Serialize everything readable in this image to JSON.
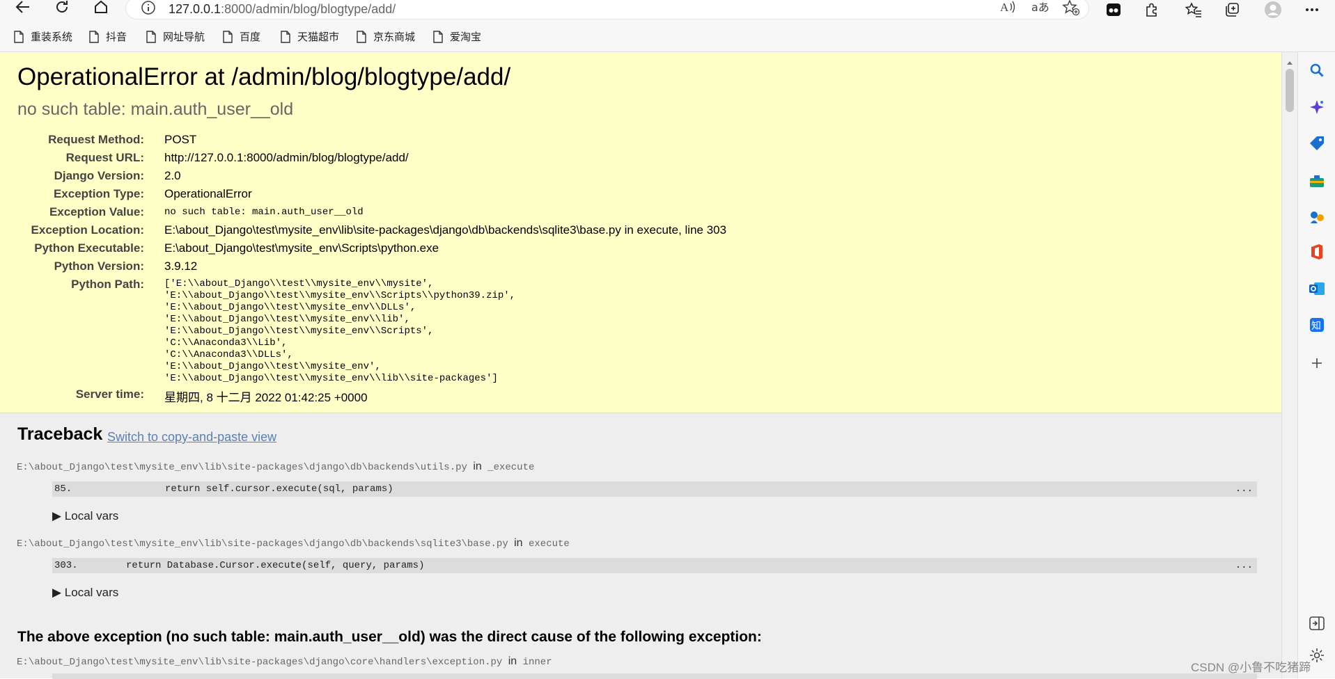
{
  "browser": {
    "url_host": "127.0.0.1",
    "url_path": ":8000/admin/blog/blogtype/add/",
    "bookmarks": [
      "重装系统",
      "抖音",
      "网址导航",
      "百度",
      "天猫超市",
      "京东商城",
      "爱淘宝"
    ]
  },
  "error": {
    "title": "OperationalError at /admin/blog/blogtype/add/",
    "subtitle": "no such table: main.auth_user__old",
    "meta": [
      {
        "key": "Request Method:",
        "value": "POST"
      },
      {
        "key": "Request URL:",
        "value": "http://127.0.0.1:8000/admin/blog/blogtype/add/"
      },
      {
        "key": "Django Version:",
        "value": "2.0"
      },
      {
        "key": "Exception Type:",
        "value": "OperationalError"
      },
      {
        "key": "Exception Value:",
        "value": "no such table: main.auth_user__old"
      },
      {
        "key": "Exception Location:",
        "value": "E:\\about_Django\\test\\mysite_env\\lib\\site-packages\\django\\db\\backends\\sqlite3\\base.py in execute, line 303"
      },
      {
        "key": "Python Executable:",
        "value": "E:\\about_Django\\test\\mysite_env\\Scripts\\python.exe"
      },
      {
        "key": "Python Version:",
        "value": "3.9.12"
      },
      {
        "key": "Python Path:",
        "value": ""
      }
    ],
    "python_path": [
      "['E:\\\\about_Django\\\\test\\\\mysite_env\\\\mysite',",
      " 'E:\\\\about_Django\\\\test\\\\mysite_env\\\\Scripts\\\\python39.zip',",
      " 'E:\\\\about_Django\\\\test\\\\mysite_env\\\\DLLs',",
      " 'E:\\\\about_Django\\\\test\\\\mysite_env\\\\lib',",
      " 'E:\\\\about_Django\\\\test\\\\mysite_env\\\\Scripts',",
      " 'C:\\\\Anaconda3\\\\Lib',",
      " 'C:\\\\Anaconda3\\\\DLLs',",
      " 'E:\\\\about_Django\\\\test\\\\mysite_env',",
      " 'E:\\\\about_Django\\\\test\\\\mysite_env\\\\lib\\\\site-packages']"
    ],
    "server_time_key": "Server time:",
    "server_time": "星期四, 8 十二月 2022 01:42:25 +0000"
  },
  "traceback": {
    "heading": "Traceback",
    "switch_link": "Switch to copy-and-paste view",
    "frames": [
      {
        "file": "E:\\about_Django\\test\\mysite_env\\lib\\site-packages\\django\\db\\backends\\utils.py",
        "in": "in",
        "func": "_execute",
        "line_no": "85.",
        "code": "return self.cursor.execute(sql, params)",
        "dots": "...",
        "local_vars": "▶ Local vars"
      },
      {
        "file": "E:\\about_Django\\test\\mysite_env\\lib\\site-packages\\django\\db\\backends\\sqlite3\\base.py",
        "in": "in",
        "func": "execute",
        "line_no": "303.",
        "code": "return Database.Cursor.execute(self, query, params)",
        "dots": "...",
        "local_vars": "▶ Local vars"
      }
    ],
    "cause": "The above exception (no such table: main.auth_user__old) was the direct cause of the following exception:",
    "next_file": "E:\\about_Django\\test\\mysite_env\\lib\\site-packages\\django\\core\\handlers\\exception.py",
    "next_in": "in",
    "next_func": "inner"
  },
  "watermark": "CSDN @小鲁不吃猪蹄",
  "icons": [
    "back-icon",
    "refresh-icon",
    "home-icon",
    "info-icon",
    "read-aloud-icon",
    "translate-icon",
    "favorite-add-icon",
    "extension-icon",
    "puzzle-icon",
    "favorites-icon",
    "collections-icon",
    "profile-icon",
    "more-icon",
    "search-icon",
    "copilot-icon",
    "shopping-icon",
    "tools-icon",
    "games-icon",
    "office-icon",
    "outlook-icon",
    "zhihu-icon",
    "add-icon",
    "sidebar-toggle-icon",
    "settings-icon"
  ]
}
